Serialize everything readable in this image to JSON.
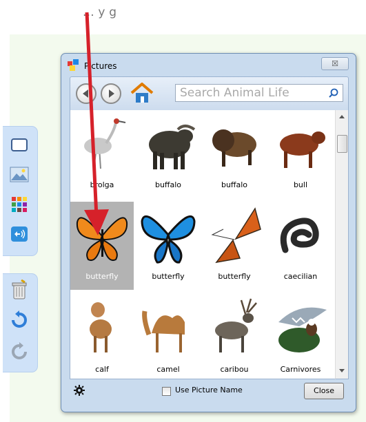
{
  "caption": "... y                              g",
  "dialog": {
    "title": "Pictures",
    "close_glyph": "☒"
  },
  "search": {
    "placeholder": "Search Animal Life"
  },
  "tiles": [
    {
      "label": "brolga",
      "animal": "crane",
      "selected": false
    },
    {
      "label": "buffalo",
      "animal": "cape-buffalo",
      "selected": false
    },
    {
      "label": "buffalo",
      "animal": "bison",
      "selected": false
    },
    {
      "label": "bull",
      "animal": "bull",
      "selected": false
    },
    {
      "label": "butterfly",
      "animal": "monarch-butterfly",
      "selected": true
    },
    {
      "label": "butterfly",
      "animal": "blue-butterfly",
      "selected": false
    },
    {
      "label": "butterfly",
      "animal": "orange-moth",
      "selected": false
    },
    {
      "label": "caecilian",
      "animal": "caecilian",
      "selected": false
    },
    {
      "label": "calf",
      "animal": "calf",
      "selected": false
    },
    {
      "label": "camel",
      "animal": "camel",
      "selected": false
    },
    {
      "label": "caribou",
      "animal": "caribou",
      "selected": false
    },
    {
      "label": "Carnivores",
      "animal": "shark-eagle",
      "selected": false
    }
  ],
  "bottom": {
    "checkbox_label": "Use Picture Name",
    "close_label": "Close"
  },
  "colors": {
    "accent": "#d6212a",
    "selection": "#b3b3b3",
    "panel": "#cfe2f8"
  },
  "icons": [
    "settings-gear-icon",
    "home-icon",
    "search-icon",
    "back-icon",
    "forward-icon",
    "trash-icon",
    "undo-icon",
    "redo-icon"
  ]
}
